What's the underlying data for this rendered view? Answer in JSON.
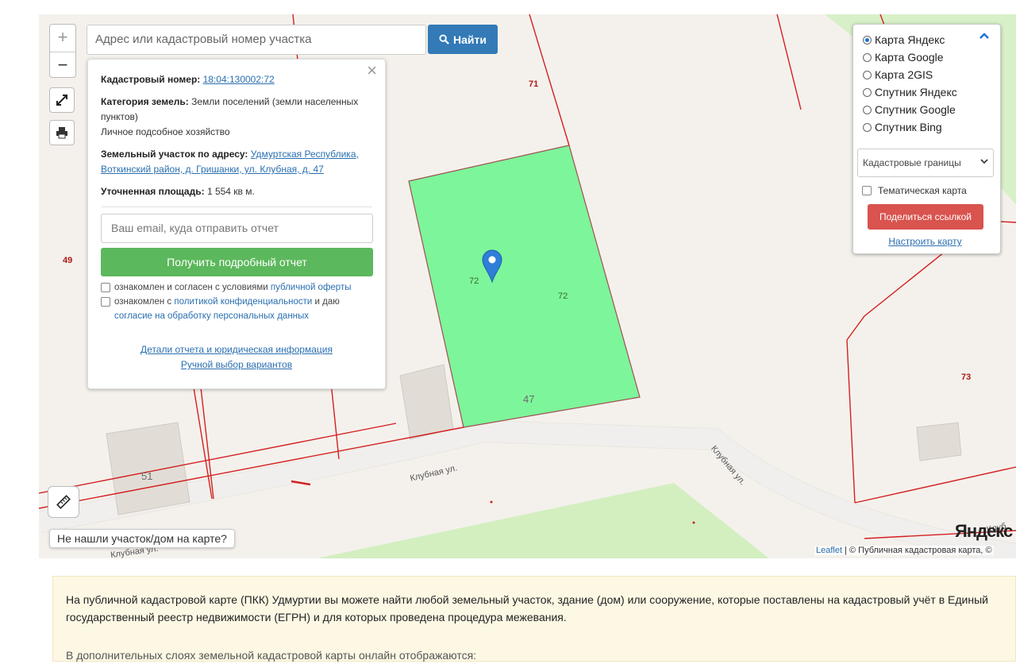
{
  "search": {
    "placeholder": "Адрес или кадастровый номер участка",
    "button_label": "Найти"
  },
  "zoom": {
    "in_label": "+",
    "out_label": "−"
  },
  "info_panel": {
    "cadastral_label": "Кадастровый номер:",
    "cadastral_value": "18:04:130002:72",
    "category_label": "Категория земель:",
    "category_value": "Земли поселений (земли населенных пунктов)",
    "usage": "Личное подсобное хозяйство",
    "address_label": "Земельный участок по адресу:",
    "address_value": "Удмуртская Республика, Воткинский район, д. Гришанки, ул. Клубная, д. 47",
    "area_label": "Уточненная площадь:",
    "area_value": "1 554 кв м.",
    "email_placeholder": "Ваш email, куда отправить отчет",
    "report_button": "Получить подробный отчет",
    "consent1_text": "ознакомлен и согласен с условиями",
    "consent1_link": "публичной оферты",
    "consent2_text_a": "ознакомлен с",
    "consent2_link_a": "политикой конфиденциальности",
    "consent2_text_b": "и даю",
    "consent2_link_b": "согласие на обработку персональных данных",
    "link_details": "Детали отчета и юридическая информация",
    "link_manual": "Ручной выбор вариантов"
  },
  "layers": {
    "options": [
      {
        "label": "Карта Яндекс",
        "selected": true
      },
      {
        "label": "Карта Google",
        "selected": false
      },
      {
        "label": "Карта 2GIS",
        "selected": false
      },
      {
        "label": "Спутник Яндекс",
        "selected": false
      },
      {
        "label": "Спутник Google",
        "selected": false
      },
      {
        "label": "Спутник Bing",
        "selected": false
      }
    ],
    "select_value": "Кадастровые границы",
    "thematic_label": "Тематическая карта",
    "share_button": "Поделиться ссылкой",
    "customize_link": "Настроить карту"
  },
  "map": {
    "plot_numbers": [
      "71",
      "49",
      "73",
      "72",
      "72"
    ],
    "house_numbers": [
      "47",
      "51"
    ],
    "streets": [
      "Клубная ул.",
      "Клубная ул.",
      "Клубная ул.",
      "Клуб"
    ],
    "not_found_label": "Не нашли участок/дом на карте?",
    "yandex_logo": "Яндекс",
    "attribution_leaflet": "Leaflet",
    "attribution_text": "| © Публичная кадастровая карта, ©"
  },
  "footer": {
    "paragraph1": "На публичной кадастровой карте (ПКК) Удмуртии вы можете найти любой земельный участок, здание (дом) или сооружение, которые поставлены на кадастровый учёт в Единый государственный реестр недвижимости (ЕГРН) и для которых проведена процедура межевания.",
    "paragraph2": "В дополнительных слоях земельной кадастровой карты онлайн отображаются:"
  },
  "colors": {
    "plot_fill": "#7df59b",
    "boundary": "#d42020",
    "search_button": "#337ab7",
    "report_button": "#5cb85c",
    "share_button": "#d9534f"
  }
}
